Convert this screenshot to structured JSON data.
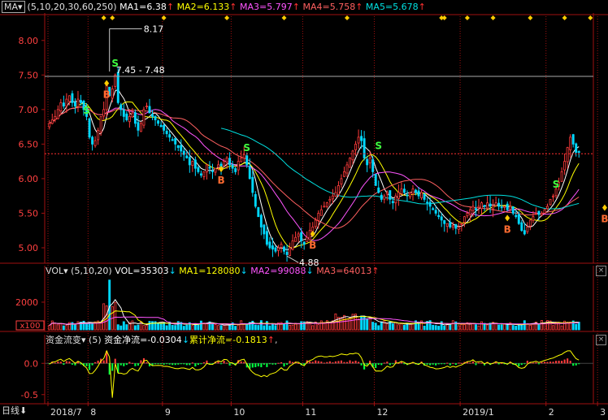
{
  "colors": {
    "background": "#000000",
    "up": "#ff3b3b",
    "down": "#00d8ff",
    "ma1": "#ffffff",
    "ma2": "#ffff00",
    "ma3": "#ff55ff",
    "ma4": "#ff6060",
    "ma5": "#00e0e0",
    "axis": "#a01010"
  },
  "price_panel": {
    "indicator_tag": "MA",
    "params": "(5,10,20,30,60,250)",
    "ma1_label": "MA1=6.38",
    "ma2_label": "MA2=6.133",
    "ma3_label": "MA3=5.797",
    "ma4_label": "MA4=5.758",
    "ma5_label": "MA5=5.678",
    "arrow_up": "↑",
    "arrow_down": "↓",
    "high_label": "8.17",
    "high_value": 8.17,
    "range_label": "7.45 - 7.48",
    "range_value": 7.48,
    "low_label": "4.88",
    "low_value": 4.88,
    "ref_value": 6.36,
    "axis_min": 4.8,
    "axis_max": 8.35,
    "y_ticks": [
      {
        "value": 8.0,
        "label": "8.00"
      },
      {
        "value": 7.5,
        "label": "7.50"
      },
      {
        "value": 7.0,
        "label": "7.00"
      },
      {
        "value": 6.5,
        "label": "6.50"
      },
      {
        "value": 6.0,
        "label": "6.00"
      },
      {
        "value": 5.5,
        "label": "5.50"
      },
      {
        "value": 5.0,
        "label": "5.00"
      }
    ],
    "signals": [
      {
        "type": "B",
        "index": 20,
        "price": 7.38
      },
      {
        "type": "S",
        "index": 23,
        "price": 7.55
      },
      {
        "type": "S",
        "index": 13,
        "price": 6.87
      },
      {
        "type": "B",
        "index": 60,
        "price": 6.14
      },
      {
        "type": "S",
        "index": 69,
        "price": 6.33
      },
      {
        "type": "B",
        "index": 92,
        "price": 5.2
      },
      {
        "type": "S",
        "index": 115,
        "price": 6.36
      },
      {
        "type": "B",
        "index": 160,
        "price": 5.43
      },
      {
        "type": "S",
        "index": 177,
        "price": 5.8
      },
      {
        "type": "B",
        "index": 194,
        "price": 5.58
      }
    ],
    "event_markers": [
      19,
      22,
      40,
      62,
      82,
      104,
      137,
      138,
      146,
      155,
      168,
      180,
      189,
      201
    ]
  },
  "volume_panel": {
    "indicator_tag": "VOL",
    "params": "(5,10,20)",
    "vol_label": "VOL=35303",
    "ma1_label": "MA1=128080",
    "ma2_label": "MA2=99088",
    "ma3_label": "MA3=64013",
    "tick_label": "2000",
    "tick_value": 2000,
    "axis_max": 3700,
    "unit_label": "x100"
  },
  "flow_panel": {
    "indicator_tag": "资金流变",
    "params": "(5)",
    "net_label": "资金净流=-0.0304",
    "cum_label": "累计净流=-0.1813",
    "tail": ",",
    "y_ticks": [
      {
        "value": 0.0,
        "label": "0.0"
      },
      {
        "value": -0.5,
        "label": "-0.5"
      }
    ],
    "axis_min": -0.62,
    "axis_max": 0.25
  },
  "chart_data": {
    "type": "candlestick",
    "x_labels": [
      {
        "index": 0,
        "label": "2018/7"
      },
      {
        "index": 14,
        "label": "8"
      },
      {
        "index": 40,
        "label": "9"
      },
      {
        "index": 64,
        "label": "10"
      },
      {
        "index": 89,
        "label": "11"
      },
      {
        "index": 114,
        "label": "12"
      },
      {
        "index": 144,
        "label": "2019/1"
      },
      {
        "index": 174,
        "label": "2"
      },
      {
        "index": 192,
        "label": "3"
      }
    ],
    "series": [
      {
        "name": "MA1",
        "values": []
      },
      {
        "name": "MA2",
        "values": []
      },
      {
        "name": "MA3",
        "values": []
      },
      {
        "name": "MA4",
        "values": []
      },
      {
        "name": "MA5",
        "values": []
      },
      {
        "name": "VOL",
        "values": []
      },
      {
        "name": "资金净流",
        "values": []
      }
    ],
    "closes": [
      6.8,
      6.85,
      6.9,
      7.0,
      7.1,
      7.05,
      7.15,
      7.2,
      7.1,
      7.05,
      7.15,
      7.1,
      7.0,
      6.9,
      6.6,
      6.5,
      6.55,
      6.7,
      6.9,
      7.0,
      7.35,
      7.2,
      7.3,
      7.5,
      7.1,
      7.0,
      6.9,
      6.85,
      6.9,
      6.95,
      6.8,
      6.7,
      6.8,
      7.0,
      7.05,
      6.95,
      6.9,
      6.85,
      6.8,
      6.75,
      6.7,
      6.65,
      6.6,
      6.55,
      6.5,
      6.45,
      6.4,
      6.35,
      6.3,
      6.2,
      6.25,
      6.15,
      6.1,
      6.05,
      6.1,
      6.2,
      6.15,
      6.1,
      6.15,
      6.2,
      6.15,
      6.25,
      6.3,
      6.2,
      6.15,
      6.1,
      6.25,
      6.3,
      6.35,
      6.2,
      6.0,
      5.8,
      5.6,
      5.45,
      5.3,
      5.2,
      5.05,
      5.0,
      4.98,
      4.95,
      5.0,
      5.05,
      4.95,
      4.9,
      5.0,
      5.1,
      5.15,
      5.2,
      5.1,
      5.05,
      5.15,
      5.25,
      5.3,
      5.4,
      5.5,
      5.55,
      5.6,
      5.65,
      5.7,
      5.75,
      5.8,
      5.9,
      6.0,
      6.1,
      6.2,
      6.3,
      6.4,
      6.5,
      6.6,
      6.55,
      6.3,
      6.2,
      6.3,
      6.1,
      5.9,
      5.8,
      5.7,
      5.75,
      5.8,
      5.7,
      5.65,
      5.75,
      5.8,
      5.85,
      5.8,
      5.75,
      5.8,
      5.85,
      5.8,
      5.75,
      5.8,
      5.7,
      5.65,
      5.6,
      5.55,
      5.5,
      5.45,
      5.4,
      5.35,
      5.35,
      5.3,
      5.32,
      5.28,
      5.3,
      5.35,
      5.45,
      5.5,
      5.55,
      5.6,
      5.55,
      5.6,
      5.65,
      5.6,
      5.65,
      5.6,
      5.6,
      5.65,
      5.6,
      5.58,
      5.6,
      5.55,
      5.6,
      5.5,
      5.45,
      5.35,
      5.25,
      5.2,
      5.3,
      5.4,
      5.45,
      5.5,
      5.48,
      5.5,
      5.55,
      5.6,
      5.7,
      5.75,
      5.85,
      5.95,
      6.1,
      6.25,
      6.45,
      6.6,
      6.5,
      6.38,
      6.38
    ]
  }
}
